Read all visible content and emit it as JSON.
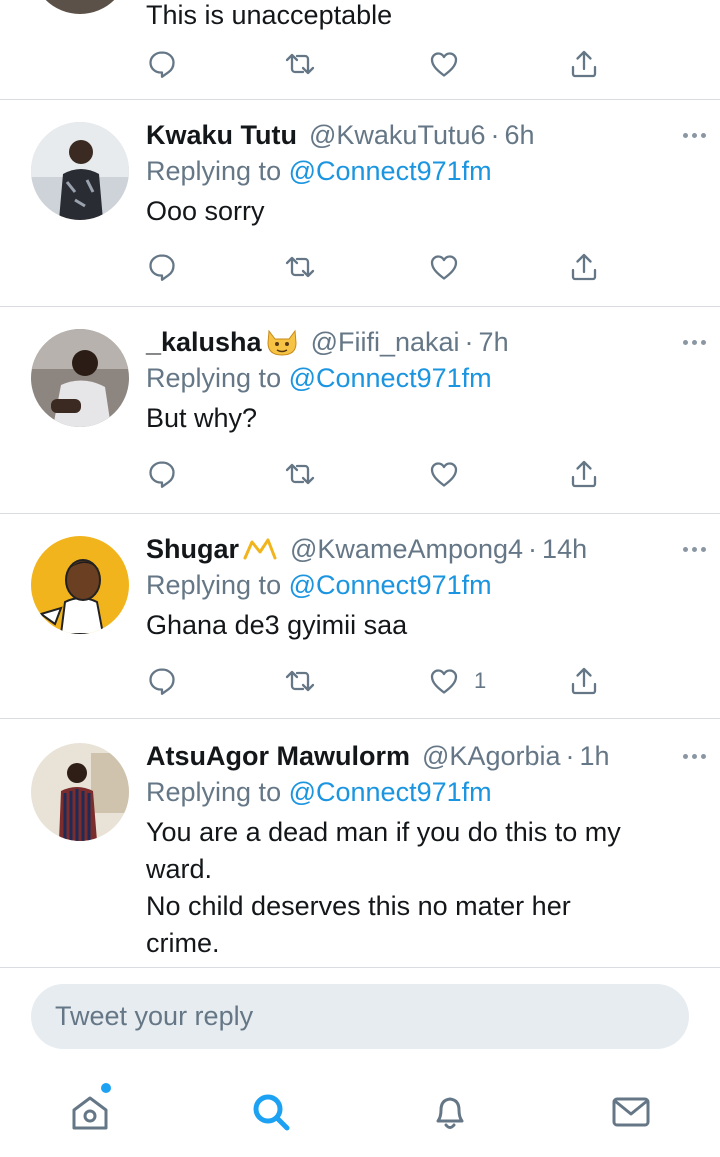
{
  "tweets": [
    {
      "text": "This is unacceptable"
    },
    {
      "name": "Kwaku Tutu",
      "handle": "@KwakuTutu6",
      "time": "6h",
      "replying_prefix": "Replying to ",
      "replying_to": "@Connect971fm",
      "text": "Ooo sorry",
      "like_count": ""
    },
    {
      "name": "_kalusha",
      "name_emoji": "cat-face-emoji",
      "handle": "@Fiifi_nakai",
      "time": "7h",
      "replying_prefix": "Replying to ",
      "replying_to": "@Connect971fm",
      "text": "But why?",
      "like_count": ""
    },
    {
      "name": "Shugar",
      "name_emoji": "crown-emoji",
      "handle": "@KwameAmpong4",
      "time": "14h",
      "replying_prefix": "Replying to ",
      "replying_to": "@Connect971fm",
      "text": "Ghana de3 gyimii saa",
      "like_count": "1"
    },
    {
      "name": "AtsuAgor Mawulorm",
      "handle": "@KAgorbia",
      "time": "1h",
      "replying_prefix": "Replying to ",
      "replying_to": "@Connect971fm",
      "text_lines": [
        "You are a dead man if you do this to my",
        "ward.",
        "No child deserves this no mater her",
        "crime."
      ]
    }
  ],
  "separator": "·",
  "reply_bar": {
    "placeholder": "Tweet your reply"
  },
  "tabbar": {
    "items": [
      "home-icon",
      "search-icon",
      "bell-icon",
      "mail-icon"
    ],
    "active": "search-icon"
  },
  "colors": {
    "accent": "#1da1f2",
    "mention": "#1b95e0",
    "secondary_text": "#657786",
    "divider": "#d9dde2"
  }
}
